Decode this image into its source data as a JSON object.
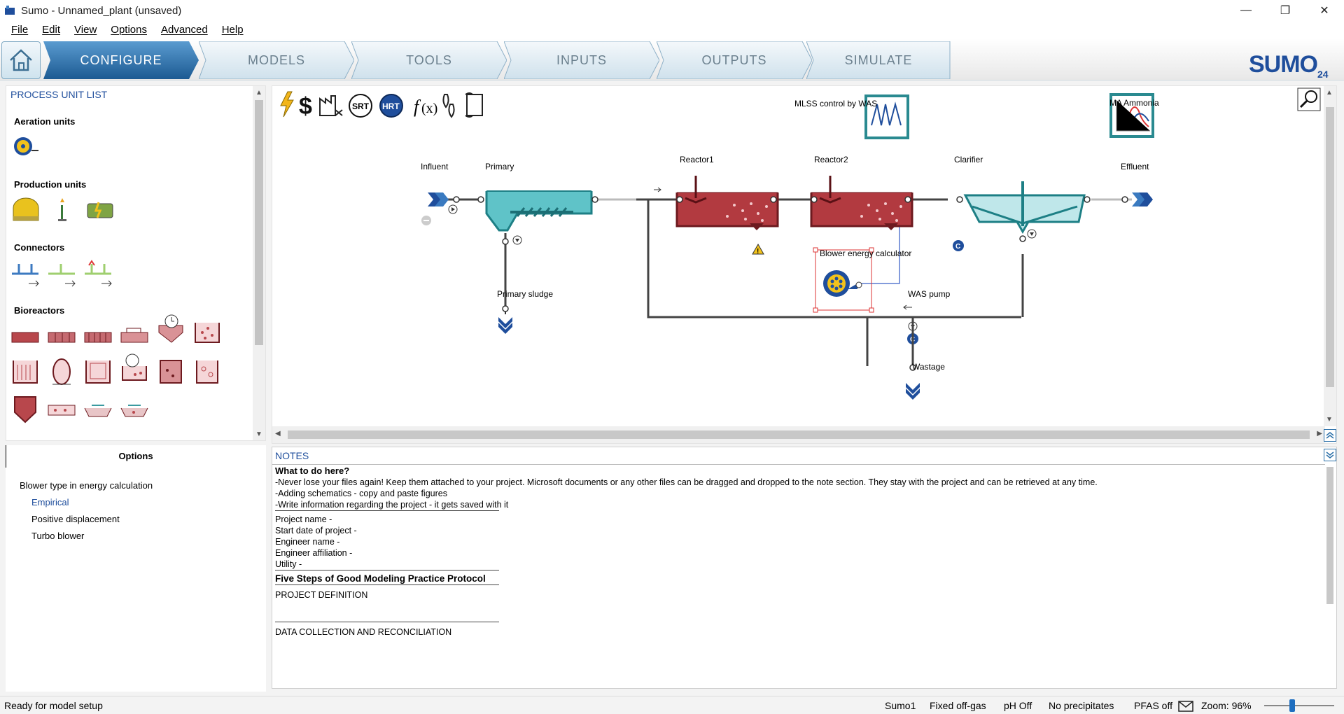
{
  "window": {
    "title": "Sumo - Unnamed_plant (unsaved)"
  },
  "menu": [
    "File",
    "Edit",
    "View",
    "Options",
    "Advanced",
    "Help"
  ],
  "tabs": [
    {
      "label": "CONFIGURE",
      "active": true
    },
    {
      "label": "MODELS",
      "active": false
    },
    {
      "label": "TOOLS",
      "active": false
    },
    {
      "label": "INPUTS",
      "active": false
    },
    {
      "label": "OUTPUTS",
      "active": false
    },
    {
      "label": "SIMULATE",
      "active": false
    }
  ],
  "logo": {
    "text": "SUMO",
    "sub": "24"
  },
  "process_unit_list": {
    "title": "PROCESS UNIT LIST",
    "sections": [
      "Aeration units",
      "Production units",
      "Connectors",
      "Bioreactors"
    ]
  },
  "options": {
    "title": "Options",
    "group": "Blower type in energy calculation",
    "items": [
      {
        "label": "Empirical",
        "selected": true
      },
      {
        "label": "Positive displacement",
        "selected": false
      },
      {
        "label": "Turbo blower",
        "selected": false
      }
    ]
  },
  "canvas": {
    "tool_icons": [
      "lightning-icon",
      "dollar-icon",
      "factory-icon",
      "srt-icon",
      "hrt-icon",
      "function-icon",
      "footprint-icon",
      "scroll-icon"
    ],
    "tool_text": {
      "srt": "SRT",
      "hrt": "HRT"
    },
    "labels": {
      "mlss": "MLSS control by WAS",
      "ma_ammonia": "MA Ammonia",
      "influent": "Influent",
      "primary": "Primary",
      "reactor1": "Reactor1",
      "reactor2": "Reactor2",
      "clarifier": "Clarifier",
      "effluent": "Effluent",
      "blower": "Blower energy calculator",
      "primary_sludge": "Primary sludge",
      "was_pump": "WAS pump",
      "wastage": "Wastage"
    }
  },
  "notes": {
    "title": "NOTES",
    "heading": "What to do here?",
    "lines": [
      "-Never lose your files again! Keep them attached to your project. Microsoft documents or any other files can be dragged and dropped to the note section. They stay with the project and can be retrieved at any time.",
      "-Adding schematics - copy and paste figures",
      "-Write information regarding the project - it gets saved with it"
    ],
    "fields": [
      "Project name -",
      "Start date of project -",
      "Engineer name -",
      "Engineer affiliation -",
      "Utility -"
    ],
    "protocol_title": "Five Steps of Good Modeling Practice Protocol",
    "project_definition": "PROJECT DEFINITION",
    "data_collection": "DATA COLLECTION AND RECONCILIATION"
  },
  "status": {
    "message": "Ready for model setup",
    "model": "Sumo1",
    "offgas": "Fixed off-gas",
    "ph": "pH Off",
    "precip": "No precipitates",
    "pfas": "PFAS off",
    "zoom": "Zoom: 96%"
  },
  "colors": {
    "accent": "#1f4e9c",
    "tab_active": "#2d6fa8",
    "reactor": "#a3272d",
    "clarifier": "#2a9aa0"
  }
}
